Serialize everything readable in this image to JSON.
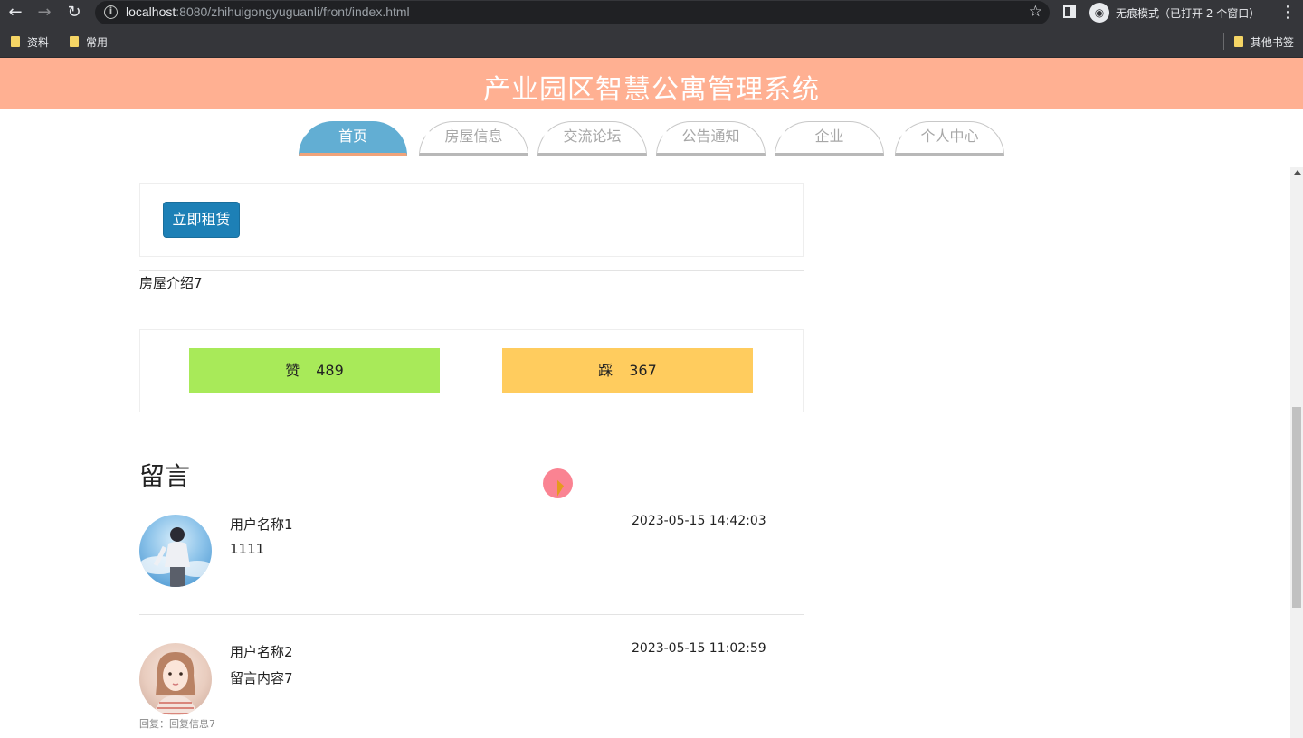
{
  "browser": {
    "url_host": "localhost",
    "url_rest": ":8080/zhihuigongyuguanli/front/index.html",
    "incognito_label": "无痕模式（已打开 2 个窗口）",
    "bookmarks": [
      "资料",
      "常用"
    ],
    "other_bookmarks": "其他书签"
  },
  "header": {
    "title": "产业园区智慧公寓管理系统"
  },
  "nav": {
    "tabs": [
      "首页",
      "房屋信息",
      "交流论坛",
      "公告通知",
      "企业",
      "个人中心"
    ],
    "active_index": 0
  },
  "detail": {
    "rent_button": "立即租赁",
    "intro": "房屋介绍7",
    "like_label": "赞",
    "like_count": "489",
    "dislike_label": "踩",
    "dislike_count": "367"
  },
  "messages": {
    "heading": "留言",
    "items": [
      {
        "user": "用户名称1",
        "content": "1111",
        "time": "2023-05-15 14:42:03"
      },
      {
        "user": "用户名称2",
        "content": "留言内容7",
        "time": "2023-05-15 11:02:59",
        "reply": "回复：回复信息7"
      }
    ]
  },
  "colors": {
    "header_bg": "#ffb092",
    "tab_active": "#62aed3",
    "rent_button": "#1d80b6",
    "like_bg": "#a8ea59",
    "dislike_bg": "#ffcc5e"
  }
}
